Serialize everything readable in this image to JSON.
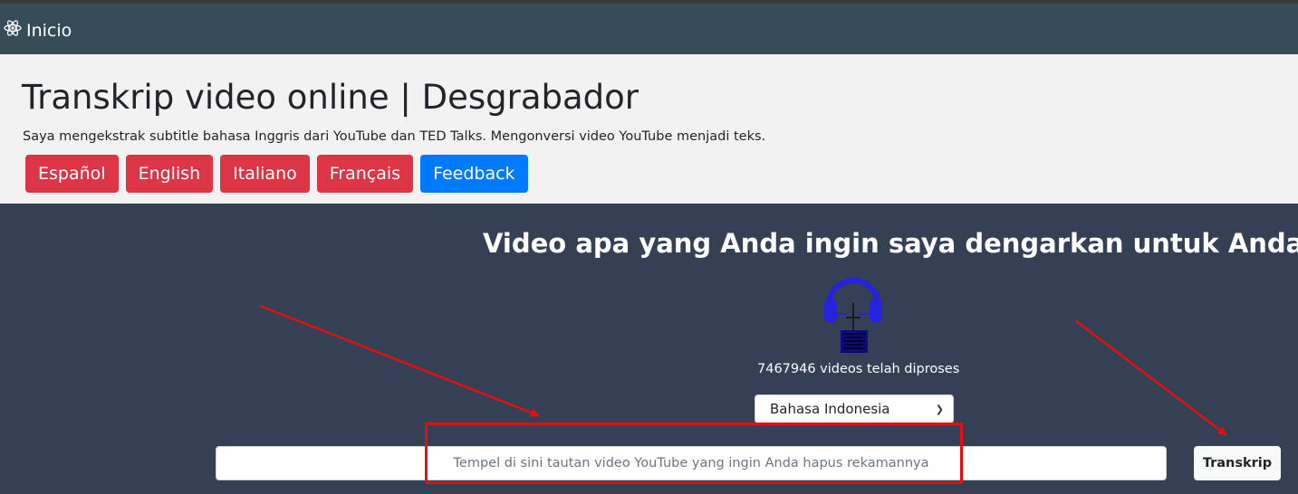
{
  "navbar": {
    "brand_label": "Inicio",
    "brand_icon": "atom-icon"
  },
  "hero": {
    "title": "Transkrip video online | Desgrabador",
    "subtitle": "Saya mengekstrak subtitle bahasa Inggris dari YouTube dan TED Talks. Mengonversi video YouTube menjadi teks.",
    "buttons": [
      {
        "label": "Español"
      },
      {
        "label": "English"
      },
      {
        "label": "Italiano"
      },
      {
        "label": "Français"
      },
      {
        "label": "Feedback"
      }
    ]
  },
  "main": {
    "question": "Video apa yang Anda ingin saya dengarkan untuk Anda?",
    "logo_icon": "headphones-icon",
    "processed_count": "7467946 videos telah diproses",
    "language_select": {
      "selected": "Bahasa Indonesia"
    },
    "url_input": {
      "placeholder": "Tempel di sini tautan video YouTube yang ingin Anda hapus rekamannya",
      "value": ""
    },
    "transcribe_label": "Transkrip"
  },
  "annotations": {
    "color": "#e31010"
  },
  "colors": {
    "navbar_bg": "#344d58",
    "hero_bg": "#f2f2f2",
    "main_bg": "#344054",
    "red_button": "#dc3545",
    "blue_button": "#007bff",
    "logo_blue": "#2323e0"
  }
}
